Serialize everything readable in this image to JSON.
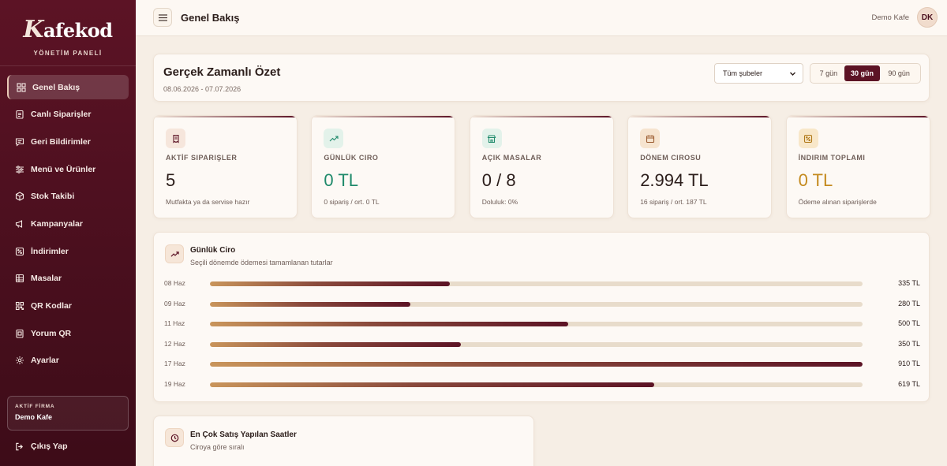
{
  "brand": {
    "logo_k": "K",
    "logo_rest": "afekod",
    "subtitle": "YÖNETİM PANELİ"
  },
  "sidebar": {
    "items": [
      {
        "label": "Genel Bakış",
        "icon": "grid-icon",
        "active": true
      },
      {
        "label": "Canlı Siparişler",
        "icon": "clipboard-icon"
      },
      {
        "label": "Geri Bildirimler",
        "icon": "message-icon"
      },
      {
        "label": "Menü ve Ürünler",
        "icon": "sliders-icon"
      },
      {
        "label": "Stok Takibi",
        "icon": "box-icon"
      },
      {
        "label": "Kampanyalar",
        "icon": "megaphone-icon"
      },
      {
        "label": "İndirimler",
        "icon": "discount-icon"
      },
      {
        "label": "Masalar",
        "icon": "table-icon"
      },
      {
        "label": "QR Kodlar",
        "icon": "qr-icon"
      },
      {
        "label": "Yorum QR",
        "icon": "review-qr-icon"
      },
      {
        "label": "Ayarlar",
        "icon": "gear-icon"
      }
    ],
    "firm_label": "AKTİF FİRMA",
    "firm_name": "Demo Kafe",
    "logout_label": "Çıkış Yap"
  },
  "topbar": {
    "title": "Genel Bakış",
    "company": "Demo Kafe",
    "avatar_initials": "DK"
  },
  "summary": {
    "title": "Gerçek Zamanlı Özet",
    "date_range": "08.06.2026 - 07.07.2026",
    "branch_selected": "Tüm şubeler",
    "ranges": [
      {
        "label": "7 gün",
        "active": false
      },
      {
        "label": "30 gün",
        "active": true
      },
      {
        "label": "90 gün",
        "active": false
      }
    ]
  },
  "stats": [
    {
      "label": "AKTİF SIPARIŞLER",
      "value": "5",
      "sub": "Mutfakta ya da servise hazır",
      "icon": "receipt-icon",
      "value_color": "#2b1d1a",
      "icon_bg": "#f6e6dc",
      "icon_color": "#5c1325"
    },
    {
      "label": "GÜNLÜK CIRO",
      "value": "0 TL",
      "sub": "0 sipariş / ort. 0 TL",
      "icon": "trend-up-icon",
      "value_color": "#1f8a6b",
      "icon_bg": "#e3f2ea",
      "icon_color": "#1f8a6b"
    },
    {
      "label": "AÇIK MASALAR",
      "value": "0 / 8",
      "sub": "Doluluk: 0%",
      "icon": "store-icon",
      "value_color": "#2b1d1a",
      "icon_bg": "#e3f2ea",
      "icon_color": "#1f8a6b"
    },
    {
      "label": "DÖNEM CIROSU",
      "value": "2.994 TL",
      "sub": "16 sipariş / ort. 187 TL",
      "icon": "calendar-icon",
      "value_color": "#2b1d1a",
      "icon_bg": "#f6e4cf",
      "icon_color": "#9a5a2e"
    },
    {
      "label": "İNDIRIM TOPLAMI",
      "value": "0 TL",
      "sub": "Ödeme alınan siparişlerde",
      "icon": "discount-icon",
      "value_color": "#c48a1e",
      "icon_bg": "#f8e7c9",
      "icon_color": "#b07818"
    }
  ],
  "daily_revenue": {
    "title": "Günlük Ciro",
    "subtitle": "Seçili dönemde ödemesi tamamlanan tutarlar",
    "max": 910,
    "rows": [
      {
        "date": "08 Haz",
        "amount": 335,
        "label": "335 TL"
      },
      {
        "date": "09 Haz",
        "amount": 280,
        "label": "280 TL"
      },
      {
        "date": "11 Haz",
        "amount": 500,
        "label": "500 TL"
      },
      {
        "date": "12 Haz",
        "amount": 350,
        "label": "350 TL"
      },
      {
        "date": "17 Haz",
        "amount": 910,
        "label": "910 TL"
      },
      {
        "date": "19 Haz",
        "amount": 619,
        "label": "619 TL"
      }
    ]
  },
  "top_hours": {
    "title": "En Çok Satış Yapılan Saatler",
    "subtitle": "Ciroya göre sıralı"
  }
}
